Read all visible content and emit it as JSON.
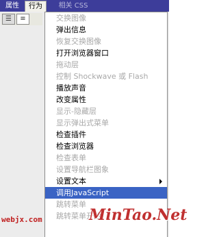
{
  "tabs": [
    {
      "label": "属性"
    },
    {
      "label": "行为"
    },
    {
      "label": "相关 CSS"
    }
  ],
  "toolbar": {
    "list_icon": "list-view-icon",
    "detail_icon": "detail-view-icon"
  },
  "menu": {
    "items": [
      {
        "label": "交换图像",
        "disabled": true
      },
      {
        "label": "弹出信息",
        "disabled": false
      },
      {
        "label": "恢复交换图像",
        "disabled": true
      },
      {
        "label": "打开浏览器窗口",
        "disabled": false
      },
      {
        "label": "拖动层",
        "disabled": true
      },
      {
        "label": "控制 Shockwave 或 Flash",
        "disabled": true
      },
      {
        "label": "播放声音",
        "disabled": false
      },
      {
        "label": "改变属性",
        "disabled": false
      },
      {
        "label": "显示-隐藏层",
        "disabled": true
      },
      {
        "label": "显示弹出式菜单",
        "disabled": true
      },
      {
        "label": "检查插件",
        "disabled": false
      },
      {
        "label": "检查浏览器",
        "disabled": false
      },
      {
        "label": "检查表单",
        "disabled": true
      },
      {
        "label": "设置导航栏图象",
        "disabled": true
      },
      {
        "label": "设置文本",
        "disabled": false,
        "submenu": true
      },
      {
        "label": "调用JavaScript",
        "disabled": false,
        "highlighted": true
      },
      {
        "label": "跳转菜单",
        "disabled": true
      },
      {
        "label": "跳转菜单开始",
        "disabled": true
      }
    ]
  },
  "watermarks": {
    "left": "webjx.com",
    "right": "MinTao.Net"
  },
  "colors": {
    "tab_bar": "#3d3d9a",
    "highlight": "#3a63c4",
    "disabled_text": "#a8a8a8",
    "watermark": "#c03030"
  }
}
